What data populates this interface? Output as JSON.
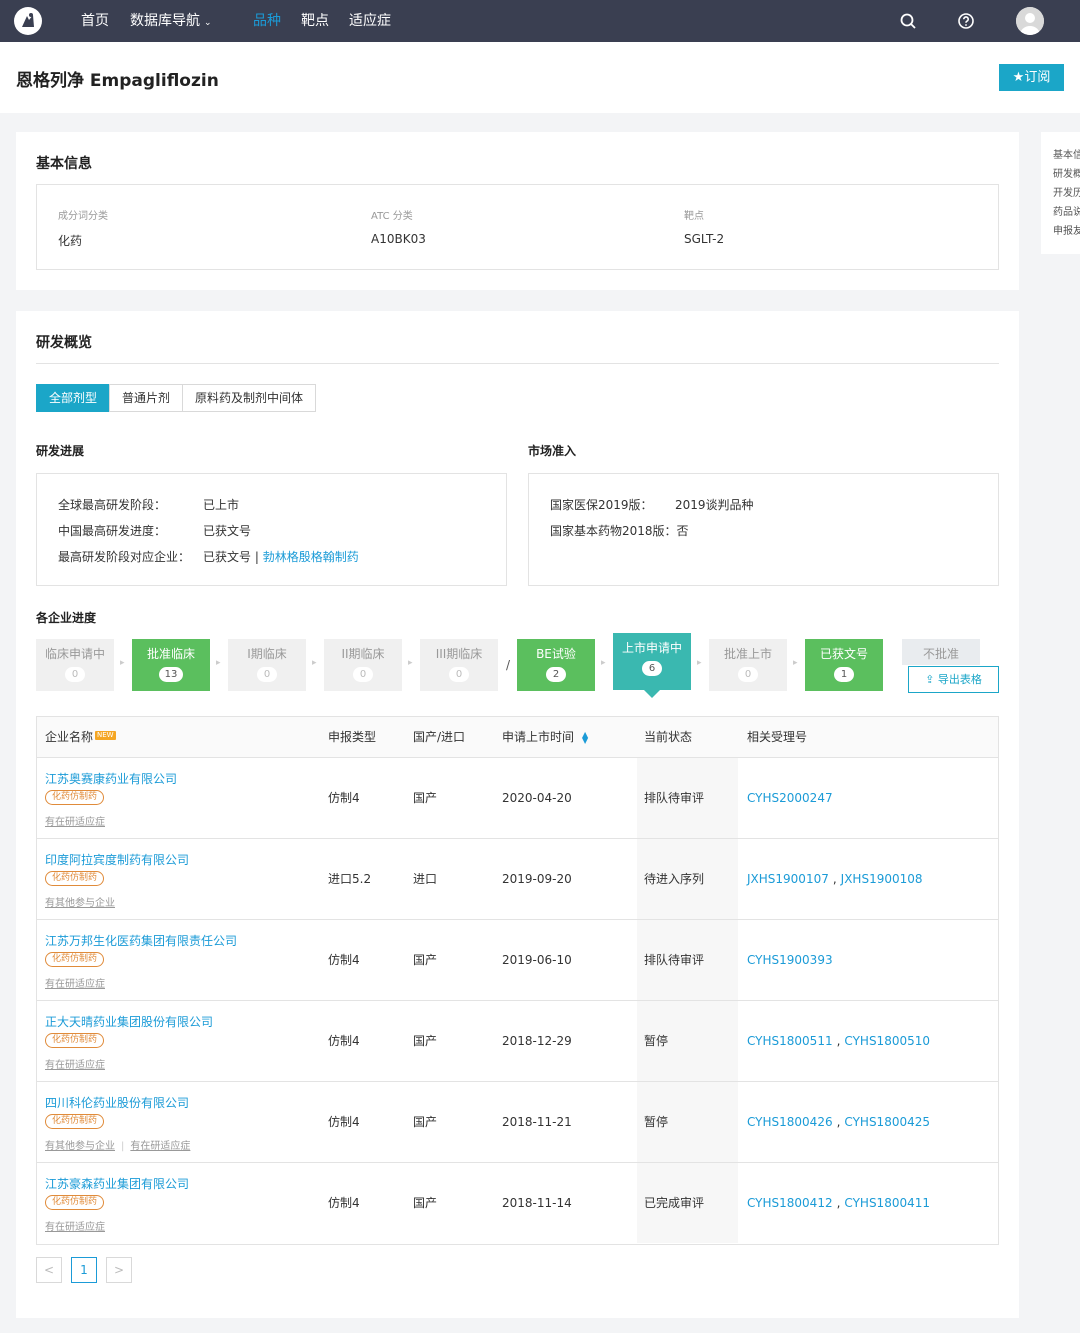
{
  "nav": {
    "items": [
      {
        "label": "首页",
        "active": false
      },
      {
        "label": "数据库导航",
        "active": false,
        "caret": "⌄"
      },
      {
        "label": "品种",
        "active": true
      },
      {
        "label": "靶点",
        "active": false
      },
      {
        "label": "适应症",
        "active": false
      }
    ],
    "icons": [
      "search-icon",
      "help-icon",
      "avatar"
    ]
  },
  "header": {
    "title": "恩格列净 Empagliflozin",
    "subscribe_label": "★订阅"
  },
  "anchor_nav": [
    "基本信",
    "研发概",
    "开发历",
    "药品说",
    "申报友"
  ],
  "basic_info": {
    "title": "基本信息",
    "fields": [
      {
        "label": "成分词分类",
        "value": "化药"
      },
      {
        "label": "ATC 分类",
        "value": "A10BK03"
      },
      {
        "label": "靶点",
        "value": "SGLT-2"
      }
    ]
  },
  "rd_overview": {
    "title": "研发概览",
    "tabs": [
      {
        "label": "全部剂型",
        "active": true
      },
      {
        "label": "普通片剂",
        "active": false
      },
      {
        "label": "原料药及制剂中间体",
        "active": false
      }
    ],
    "progress": {
      "title": "研发进展",
      "rows": [
        {
          "key": "全球最高研发阶段：",
          "value": "已上市"
        },
        {
          "key": "中国最高研发进度：",
          "value": "已获文号"
        },
        {
          "key": "最高研发阶段对应企业：",
          "value": "已获文号",
          "sep": " | ",
          "link": "勃林格殷格翰制药"
        }
      ]
    },
    "market": {
      "title": "市场准入",
      "rows": [
        {
          "key": "国家医保2019版：",
          "link": "2019谈判品种"
        },
        {
          "key": "国家基本药物2018版：",
          "value": "否"
        }
      ]
    },
    "enterprise": {
      "title": "各企业进度",
      "stages": [
        {
          "name": "临床申请中",
          "count": "0",
          "style": "gray"
        },
        {
          "name": "批准临床",
          "count": "13",
          "style": "green"
        },
        {
          "name": "I期临床",
          "count": "0",
          "style": "gray"
        },
        {
          "name": "II期临床",
          "count": "0",
          "style": "gray"
        },
        {
          "name": "III期临床",
          "count": "0",
          "style": "gray"
        },
        {
          "name": "BE试验",
          "count": "2",
          "style": "green"
        },
        {
          "name": "上市申请中",
          "count": "6",
          "style": "teal"
        },
        {
          "name": "批准上市",
          "count": "0",
          "style": "gray"
        },
        {
          "name": "已获文号",
          "count": "1",
          "style": "green"
        },
        {
          "name": "不批准",
          "count": "",
          "style": "gray2"
        }
      ],
      "slash": "/",
      "export_label": "导出表格"
    }
  },
  "table": {
    "headers": {
      "company": "企业名称",
      "new_badge": "NEW",
      "type": "申报类型",
      "origin": "国产/进口",
      "date": "申请上市时间",
      "status": "当前状态",
      "ref": "相关受理号"
    },
    "rows": [
      {
        "company": "江苏奥赛康药业有限公司",
        "tag": "化药仿制药",
        "extras": [
          "有在研适应症"
        ],
        "type": "仿制4",
        "origin": "国产",
        "date": "2020-04-20",
        "status": "排队待审评",
        "refs": [
          "CYHS2000247"
        ]
      },
      {
        "company": "印度阿拉宾度制药有限公司",
        "tag": "化药仿制药",
        "extras": [
          "有其他参与企业"
        ],
        "type": "进口5.2",
        "origin": "进口",
        "date": "2019-09-20",
        "status": "待进入序列",
        "refs": [
          "JXHS1900107",
          "JXHS1900108"
        ]
      },
      {
        "company": "江苏万邦生化医药集团有限责任公司",
        "tag": "化药仿制药",
        "extras": [
          "有在研适应症"
        ],
        "type": "仿制4",
        "origin": "国产",
        "date": "2019-06-10",
        "status": "排队待审评",
        "refs": [
          "CYHS1900393"
        ]
      },
      {
        "company": "正大天晴药业集团股份有限公司",
        "tag": "化药仿制药",
        "extras": [
          "有在研适应症"
        ],
        "type": "仿制4",
        "origin": "国产",
        "date": "2018-12-29",
        "status": "暂停",
        "refs": [
          "CYHS1800511",
          "CYHS1800510"
        ]
      },
      {
        "company": "四川科伦药业股份有限公司",
        "tag": "化药仿制药",
        "extras": [
          "有其他参与企业",
          "有在研适应症"
        ],
        "type": "仿制4",
        "origin": "国产",
        "date": "2018-11-21",
        "status": "暂停",
        "refs": [
          "CYHS1800426",
          "CYHS1800425"
        ]
      },
      {
        "company": "江苏豪森药业集团有限公司",
        "tag": "化药仿制药",
        "extras": [
          "有在研适应症"
        ],
        "type": "仿制4",
        "origin": "国产",
        "date": "2018-11-14",
        "status": "已完成审评",
        "refs": [
          "CYHS1800412",
          "CYHS1800411"
        ]
      }
    ]
  },
  "pagination": {
    "prev": "<",
    "current": "1",
    "next": ">"
  }
}
